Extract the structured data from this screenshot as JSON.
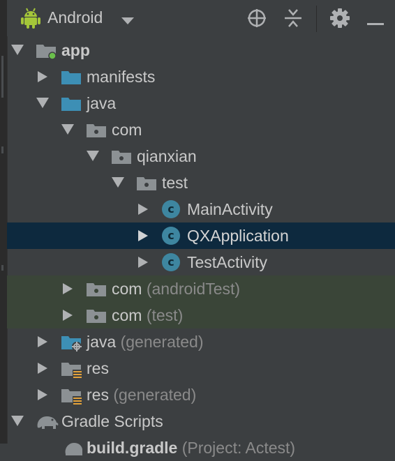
{
  "toolbar": {
    "title": "Android",
    "icons": [
      "android-icon",
      "chevron-down-icon",
      "locate-icon",
      "collapse-all-icon",
      "gear-icon",
      "minimize-icon"
    ]
  },
  "colors": {
    "background": "#3c3f41",
    "selected_row": "#0d293e",
    "test_band": "#3a4538",
    "folder_blue": "#3d8fb5",
    "class_icon": "#3e86a0",
    "android_green": "#a4c639"
  },
  "tree": {
    "app": "app",
    "manifests": "manifests",
    "java": "java",
    "com": "com",
    "qianxian": "qianxian",
    "test": "test",
    "main_activity": "MainActivity",
    "qx_application": "QXApplication",
    "test_activity": "TestActivity",
    "com_android_test": "com",
    "com_android_test_hint": "(androidTest)",
    "com_test": "com",
    "com_test_hint": "(test)",
    "java_generated": "java",
    "java_generated_hint": "(generated)",
    "res": "res",
    "res_generated": "res",
    "res_generated_hint": "(generated)",
    "gradle_scripts": "Gradle Scripts",
    "build_gradle": "build.gradle",
    "build_gradle_hint": "(Project: Actest)"
  }
}
